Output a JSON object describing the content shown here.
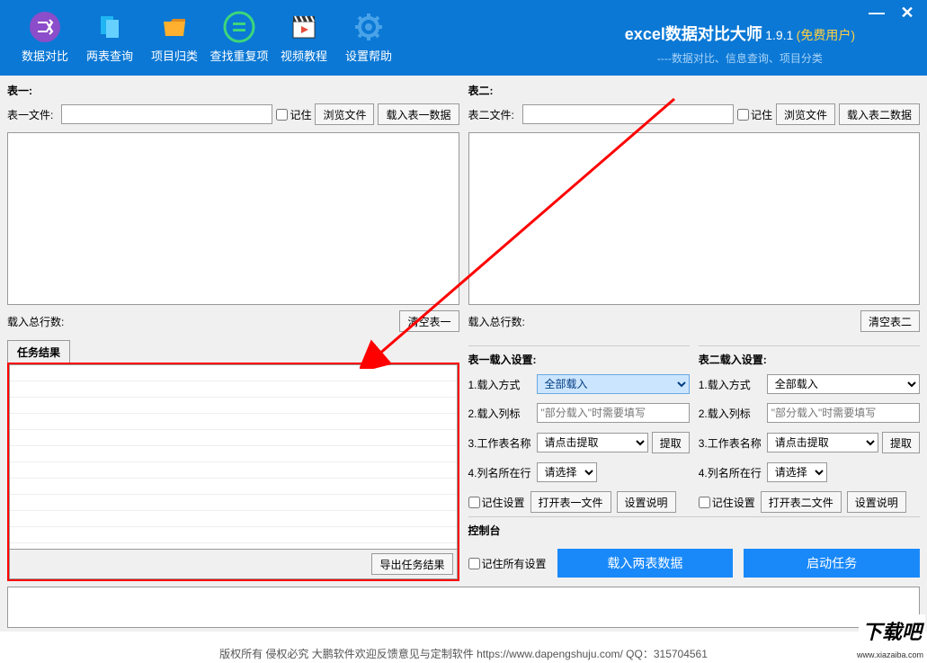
{
  "app": {
    "title": "excel数据对比大师",
    "version": "1.9.1",
    "freeUser": "(免费用户)",
    "subtitle": "----数据对比、信息查询、项目分类"
  },
  "toolbar": {
    "dataCompare": "数据对比",
    "twoTableQuery": "两表查询",
    "projectCategory": "项目归类",
    "findDuplicate": "查找重复项",
    "videoTutorial": "视频教程",
    "settingsHelp": "设置帮助"
  },
  "table1": {
    "header": "表一:",
    "fileLabel": "表一文件:",
    "remember": "记住",
    "browseBtn": "浏览文件",
    "loadBtn": "载入表一数据",
    "loadTotal": "载入总行数:",
    "clearBtn": "清空表一"
  },
  "table2": {
    "header": "表二:",
    "fileLabel": "表二文件:",
    "remember": "记住",
    "browseBtn": "浏览文件",
    "loadBtn": "载入表二数据",
    "loadTotal": "载入总行数:",
    "clearBtn": "清空表二"
  },
  "taskResult": {
    "tab": "任务结果",
    "exportBtn": "导出任务结果"
  },
  "settings1": {
    "header": "表一载入设置:",
    "loadMode": "1.载入方式",
    "loadModeVal": "全部载入",
    "loadCol": "2.载入列标",
    "loadColPlaceholder": "\"部分载入\"时需要填写",
    "sheetName": "3.工作表名称",
    "sheetNameVal": "请点击提取",
    "extractBtn": "提取",
    "colRow": "4.列名所在行",
    "colRowVal": "请选择",
    "rememberSettings": "记住设置",
    "openFile": "打开表一文件",
    "settingHelp": "设置说明"
  },
  "settings2": {
    "header": "表二载入设置:",
    "loadMode": "1.载入方式",
    "loadModeVal": "全部载入",
    "loadCol": "2.载入列标",
    "loadColPlaceholder": "\"部分载入\"时需要填写",
    "sheetName": "3.工作表名称",
    "sheetNameVal": "请点击提取",
    "extractBtn": "提取",
    "colRow": "4.列名所在行",
    "colRowVal": "请选择",
    "rememberSettings": "记住设置",
    "openFile": "打开表二文件",
    "settingHelp": "设置说明"
  },
  "control": {
    "header": "控制台",
    "rememberAll": "记住所有设置",
    "loadBoth": "载入两表数据",
    "startTask": "启动任务"
  },
  "footer": "版权所有 侵权必究 大鹏软件欢迎反馈意见与定制软件  https://www.dapengshuju.com/  QQ：315704561",
  "watermark": {
    "main": "下载吧",
    "sub": "www.xiazaiba.com"
  }
}
